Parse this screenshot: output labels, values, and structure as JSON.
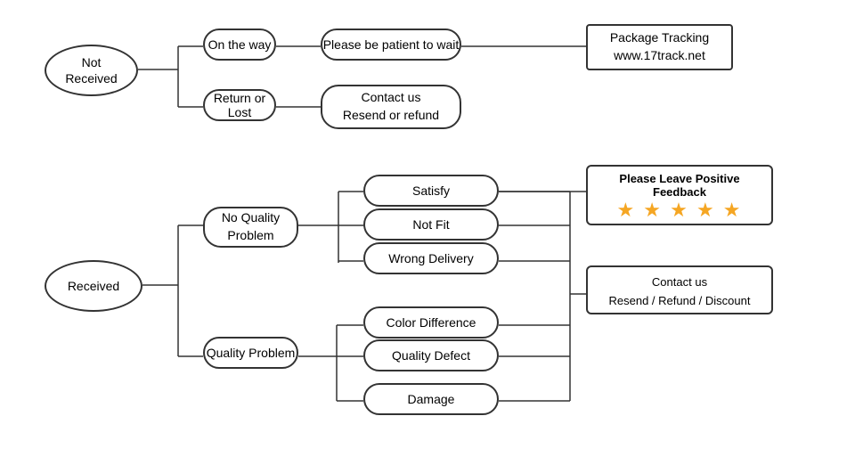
{
  "nodes": {
    "not_received": {
      "label": "Not\nReceived"
    },
    "on_the_way": {
      "label": "On the way"
    },
    "patient_wait": {
      "label": "Please be patient to wait"
    },
    "package_tracking": {
      "label": "Package Tracking\nwww.17track.net"
    },
    "return_or_lost": {
      "label": "Return or Lost"
    },
    "contact_resend_refund": {
      "label": "Contact us\nResend or refund"
    },
    "received": {
      "label": "Received"
    },
    "no_quality_problem": {
      "label": "No Quality\nProblem"
    },
    "satisfy": {
      "label": "Satisfy"
    },
    "not_fit": {
      "label": "Not Fit"
    },
    "wrong_delivery": {
      "label": "Wrong Delivery"
    },
    "quality_problem": {
      "label": "Quality Problem"
    },
    "color_difference": {
      "label": "Color Difference"
    },
    "quality_defect": {
      "label": "Quality Defect"
    },
    "damage": {
      "label": "Damage"
    },
    "please_feedback": {
      "label": "Please Leave Positive Feedback"
    },
    "contact_resend_refund_discount": {
      "label": "Contact us\nResend / Refund / Discount"
    }
  },
  "colors": {
    "star": "#f5a623",
    "border": "#333"
  }
}
